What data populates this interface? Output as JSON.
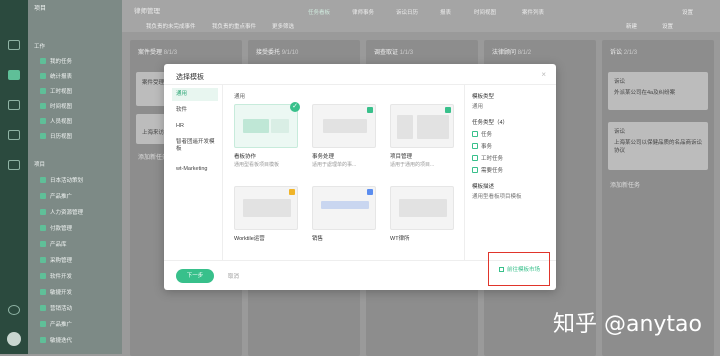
{
  "sidebar": {
    "title": "项目",
    "group_work": "工作",
    "work_items": [
      "我的任务",
      "统计报表",
      "工时视图",
      "时间视图",
      "人员视图",
      "日历视图"
    ],
    "group_project": "项目",
    "project_items": [
      "日本活动策划",
      "产品推广",
      "人力资源管理",
      "付款管理",
      "产品库",
      "采购管理",
      "软件开发",
      "敏捷开发",
      "营销活动",
      "产品推广",
      "敏捷迭代"
    ]
  },
  "topbar": {
    "project_name": "律师管理",
    "tabs": [
      "任务看板",
      "律师事务",
      "诉讼日历",
      "报表",
      "时间视图",
      "案件列表"
    ],
    "filters": [
      "我负责的未完成事件",
      "我负责的重点事件",
      "更多筛选"
    ],
    "actions": [
      "新建",
      "设置"
    ],
    "settings": "设置"
  },
  "columns": [
    {
      "title": "案件受理",
      "count": "8/1/3"
    },
    {
      "title": "接受委托",
      "count": "9/1/10"
    },
    {
      "title": "调查取证",
      "count": "1/1/3"
    },
    {
      "title": "法律顾问",
      "count": "8/1/2"
    },
    {
      "title": "诉讼",
      "count": "2/1/3"
    }
  ],
  "board_cards": {
    "col1_card1": "案件受理",
    "col1_card2": "上海来访",
    "col1_add": "添加新任务",
    "col5_card1_tag": "诉讼",
    "col5_card1_text": "外派某公司在4a及纠纷案",
    "col5_card2_tag": "诉讼",
    "col5_card2_text": "上海某公司以保健品质的名品商诉讼协议",
    "col5_add": "添加新任务"
  },
  "modal": {
    "title": "选择模板",
    "close": "×",
    "categories": [
      "通用",
      "软件",
      "HR",
      "智者团遥开发模板",
      "wt-Marketing"
    ],
    "section_label": "通用",
    "templates": [
      {
        "name": "看板协作",
        "desc": "通用型看板项目模板"
      },
      {
        "name": "事务处理",
        "desc": "适用于處理单的事..."
      },
      {
        "name": "项目管理",
        "desc": "适用于通用的项目..."
      },
      {
        "name": "Worktile运营",
        "desc": ""
      },
      {
        "name": "销售",
        "desc": ""
      },
      {
        "name": "WT律所",
        "desc": ""
      }
    ],
    "detail": {
      "type_label": "模板类型",
      "type_value": "通用",
      "task_type_label": "任务类型（4）",
      "task_types": [
        "任务",
        "事务",
        "工时任务",
        "需要任务"
      ],
      "desc_label": "模板描述",
      "desc_value": "通用型看板项目模板"
    },
    "next": "下一步",
    "cancel": "取消",
    "market": "前往模板市场"
  },
  "watermark": "知乎 @anytao",
  "colors": {
    "accent": "#38c08b",
    "highlight_border": "#e0352b"
  }
}
